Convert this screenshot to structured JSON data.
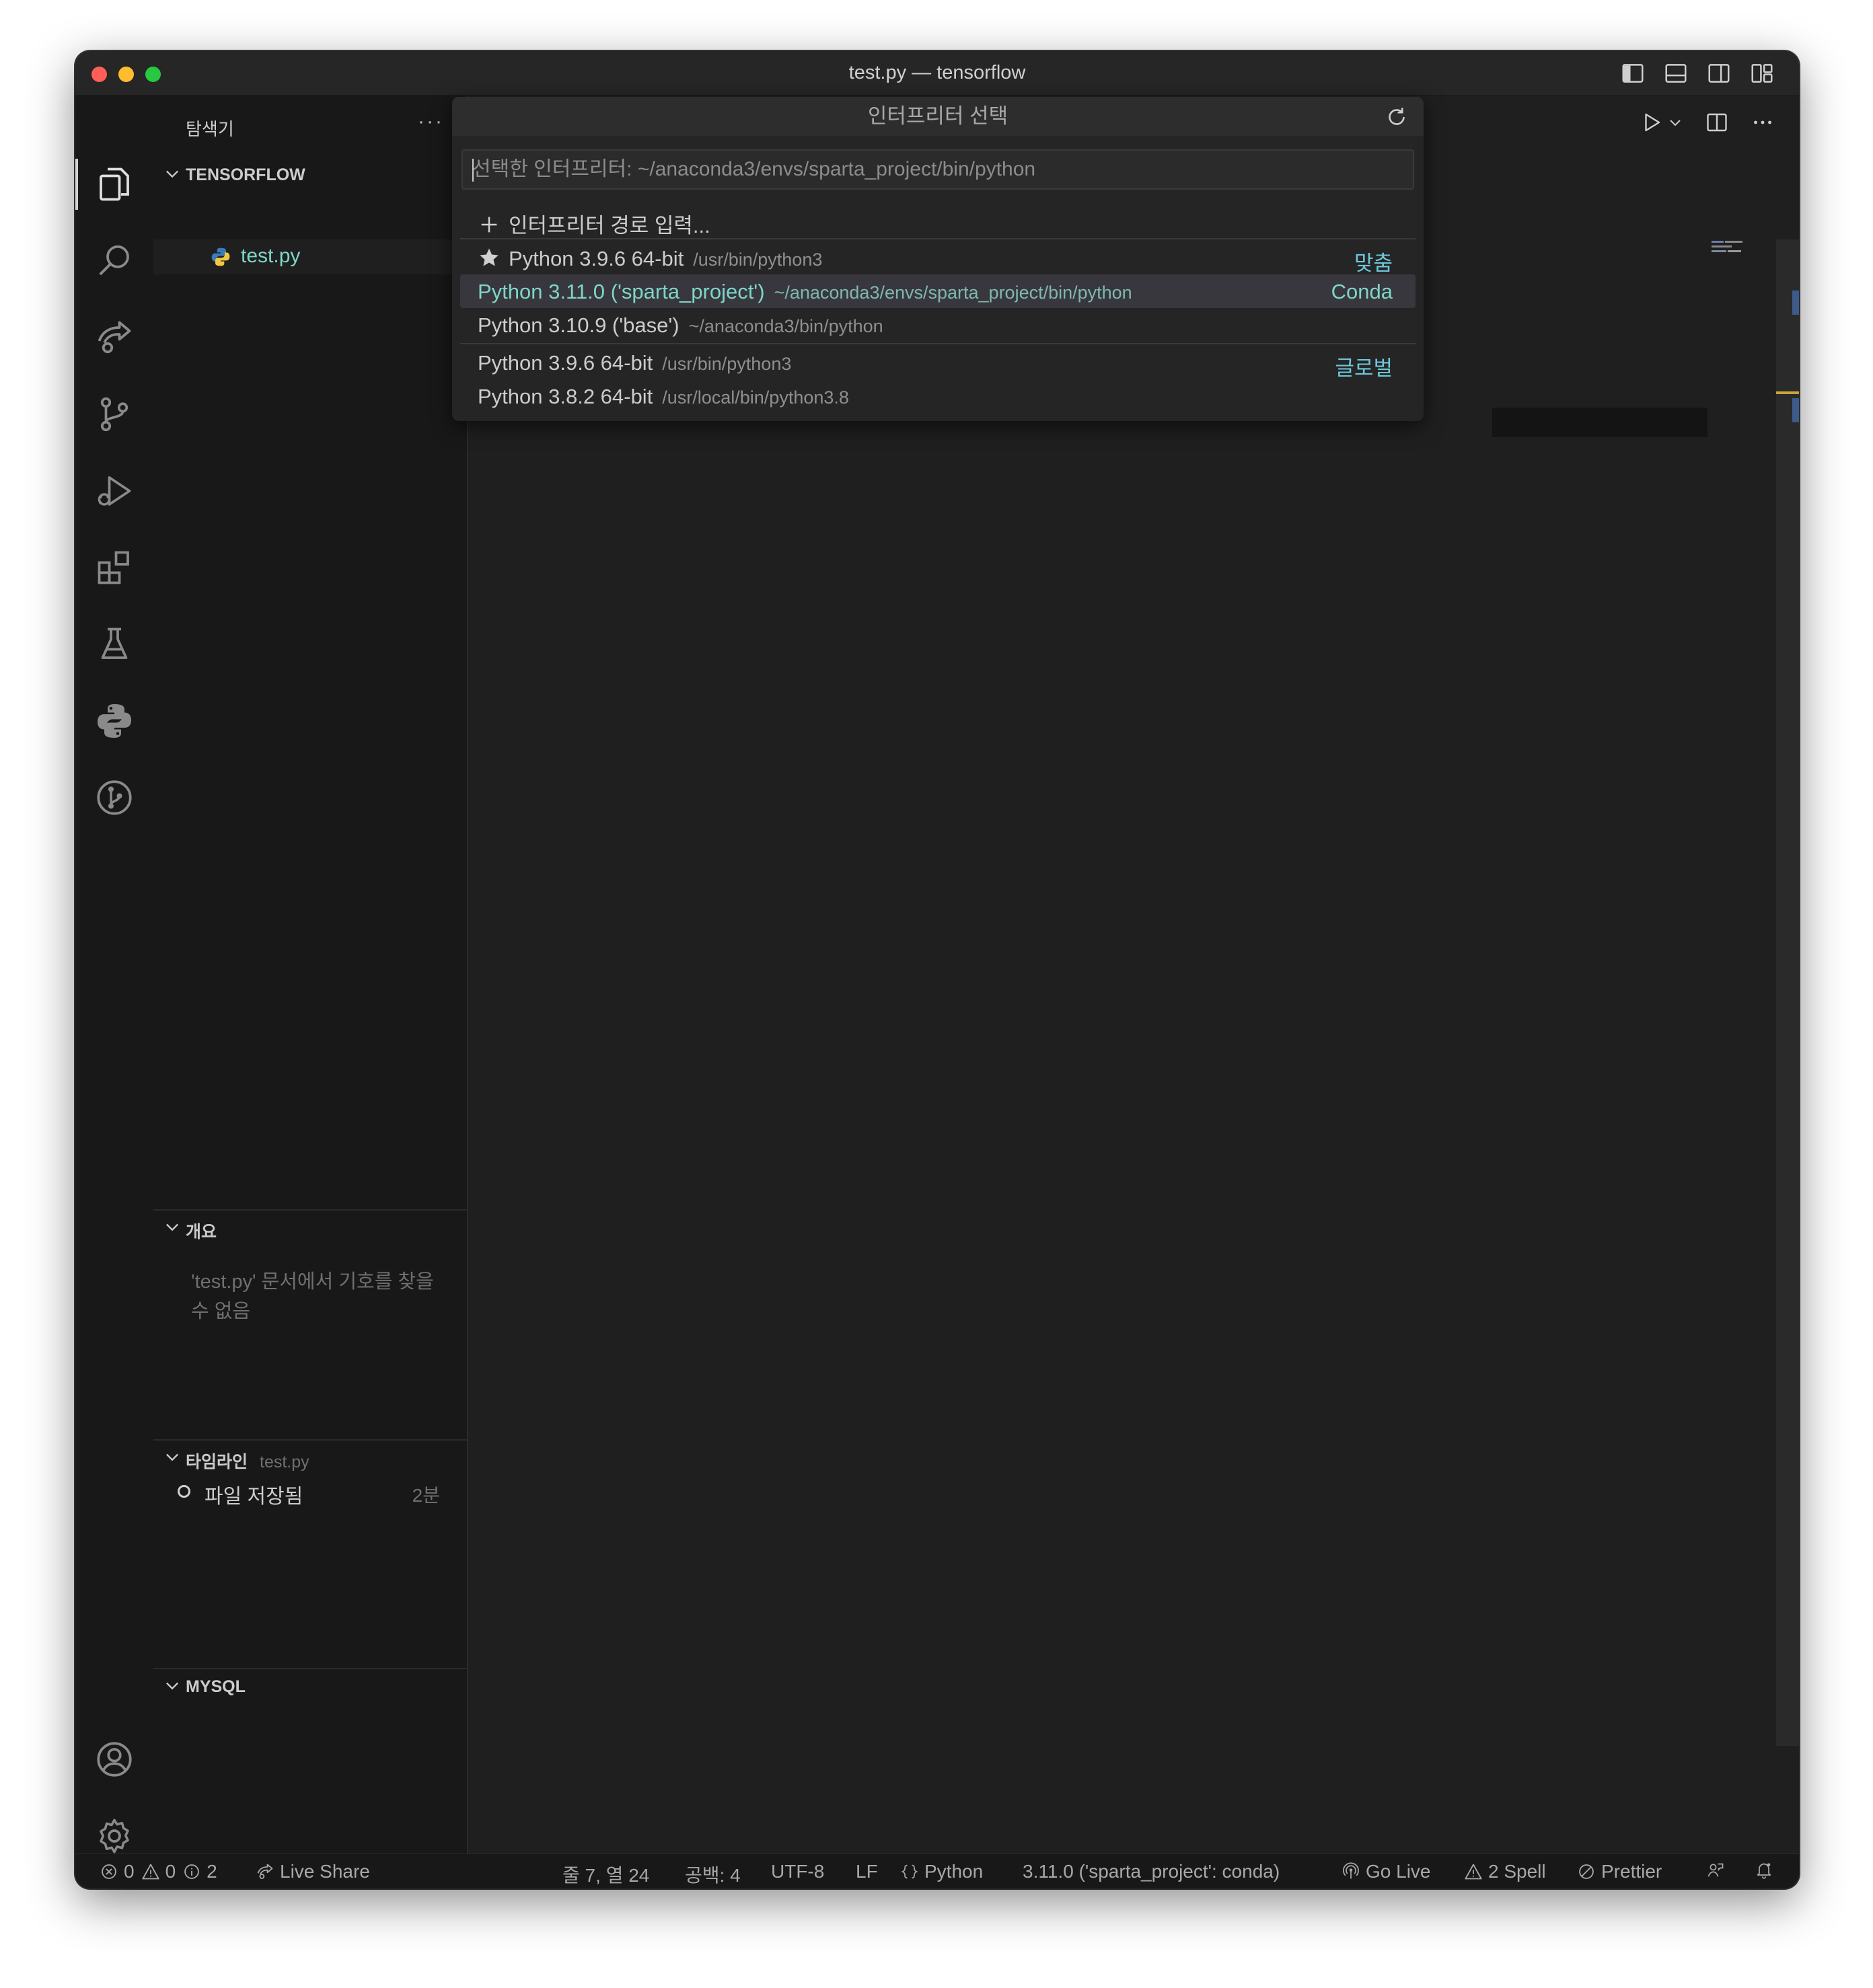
{
  "window": {
    "title": "test.py — tensorflow"
  },
  "traffic_colors": {
    "close": "#ff5f57",
    "minimize": "#febc2e",
    "zoom": "#28c840"
  },
  "activity_bar": {
    "items": [
      "explorer-icon",
      "search-icon",
      "live-share-icon",
      "source-control-icon",
      "run-debug-icon",
      "extensions-icon",
      "testing-icon",
      "python-icon",
      "git-graph-icon"
    ],
    "bottom": [
      "account-icon",
      "settings-gear-icon"
    ]
  },
  "sidebar": {
    "title": "탐색기",
    "more": "···",
    "folder": "TENSORFLOW",
    "file": "test.py",
    "outline": {
      "label": "개요",
      "message": "'test.py' 문서에서 기호를 찾을 수 없음"
    },
    "timeline": {
      "label": "타임라인",
      "file": "test.py",
      "entry": "파일 저장됨",
      "time": "2분"
    },
    "mysql": {
      "label": "MYSQL"
    }
  },
  "quick_pick": {
    "title": "인터프리터 선택",
    "input_placeholder": "선택한 인터프리터: ~/anaconda3/envs/sparta_project/bin/python",
    "enter_path": "인터프리터 경로 입력...",
    "items": [
      {
        "label": "Python 3.9.6 64-bit",
        "path": "/usr/bin/python3",
        "tag": "맞춤",
        "icon": "star-icon"
      },
      {
        "label": "Python 3.11.0 ('sparta_project')",
        "path": "~/anaconda3/envs/sparta_project/bin/python",
        "tag": "Conda",
        "selected": true
      },
      {
        "label": "Python 3.10.9 ('base')",
        "path": "~/anaconda3/bin/python",
        "tag": ""
      },
      {
        "label": "Python 3.9.6 64-bit",
        "path": "/usr/bin/python3",
        "tag": "글로벌"
      },
      {
        "label": "Python 3.8.2 64-bit",
        "path": "/usr/local/bin/python3.8",
        "tag": ""
      }
    ]
  },
  "status_bar": {
    "errors": "0",
    "warnings": "0",
    "info": "2",
    "live_share": "Live Share",
    "position": "줄 7, 열 24",
    "spaces": "공백: 4",
    "encoding": "UTF-8",
    "eol": "LF",
    "language": "Python",
    "interpreter": "3.11.0 ('sparta_project': conda)",
    "go_live": "Go Live",
    "spell": "2 Spell",
    "prettier": "Prettier"
  }
}
